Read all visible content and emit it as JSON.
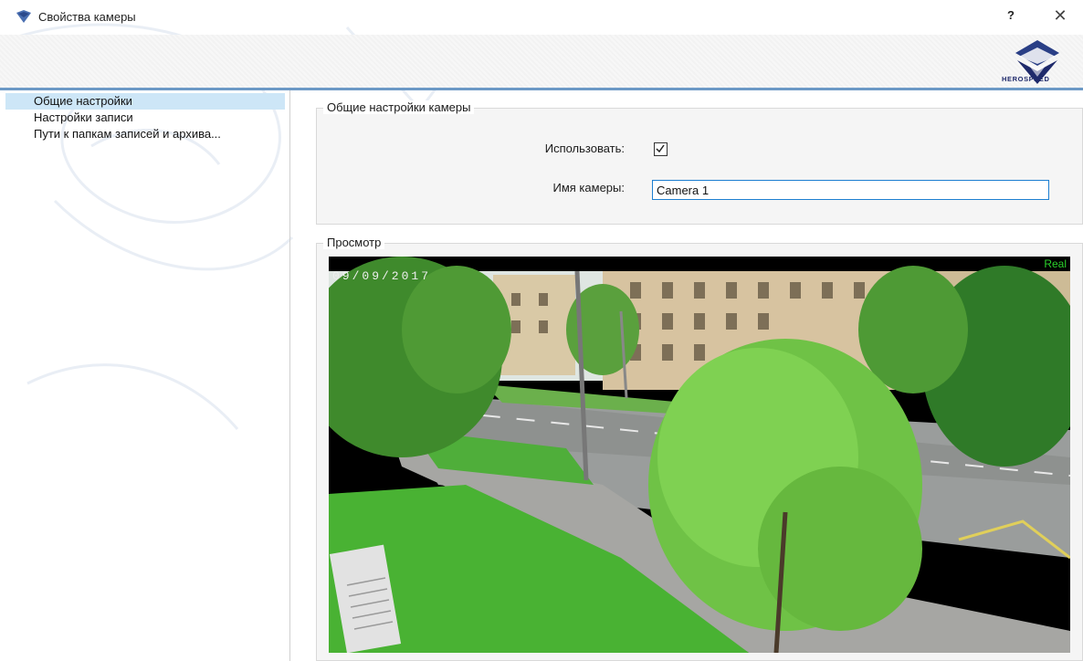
{
  "window": {
    "title": "Свойства камеры",
    "help_label": "?",
    "close_label": "✕"
  },
  "brand": {
    "name": "HEROSPEED",
    "accent": "#1f2a6b"
  },
  "nav": {
    "items": [
      {
        "label": "Общие настройки",
        "selected": true
      },
      {
        "label": "Настройки записи",
        "selected": false
      },
      {
        "label": "Пути к папкам записей и архива...",
        "selected": false
      }
    ]
  },
  "general": {
    "group_title": "Общие настройки камеры",
    "use_label": "Использовать:",
    "use_checked": true,
    "name_label": "Имя камеры:",
    "name_value": "Camera 1"
  },
  "preview": {
    "group_title": "Просмотр",
    "stream_tag": "Real",
    "osd_date": "09/09/2017"
  },
  "colors": {
    "selection": "#cde6f7",
    "header_line": "#6c99c6",
    "input_border": "#1d7fd1",
    "real_tag": "#2bd12b"
  }
}
